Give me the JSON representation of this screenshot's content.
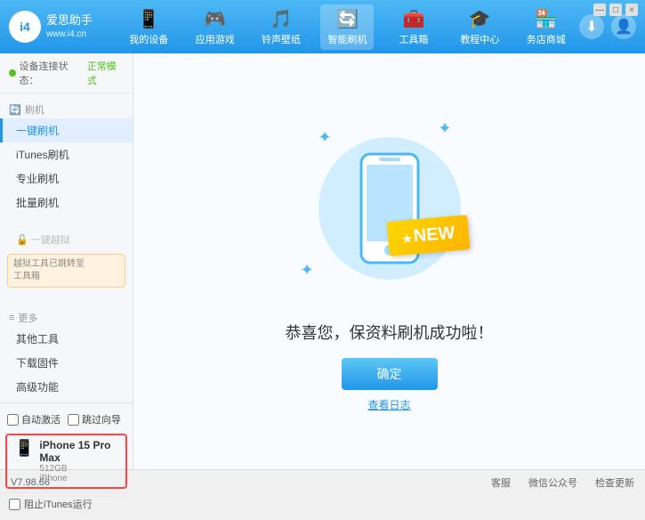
{
  "app": {
    "title": "爱思助手",
    "subtitle": "www.i4.cn",
    "version": "V7.98.66"
  },
  "window_controls": {
    "minimize": "—",
    "maximize": "□",
    "close": "×"
  },
  "nav": {
    "items": [
      {
        "id": "my-device",
        "icon": "📱",
        "label": "我的设备"
      },
      {
        "id": "apps-games",
        "icon": "🎮",
        "label": "应用游戏"
      },
      {
        "id": "ringtones",
        "icon": "🎵",
        "label": "铃声壁纸"
      },
      {
        "id": "smart-brush",
        "icon": "🔄",
        "label": "智能刷机",
        "active": true
      },
      {
        "id": "toolbox",
        "icon": "🧰",
        "label": "工具箱"
      },
      {
        "id": "tutorial",
        "icon": "🎓",
        "label": "教程中心"
      },
      {
        "id": "services",
        "icon": "🏪",
        "label": "务店商城"
      }
    ],
    "download_icon": "⬇",
    "user_icon": "👤"
  },
  "sidebar": {
    "status_label": "设备连接状态：",
    "status_value": "正常模式",
    "groups": [
      {
        "id": "brush",
        "icon": "🔄",
        "label": "刷机",
        "items": [
          {
            "id": "one-key-brush",
            "label": "一键刷机",
            "active": true
          },
          {
            "id": "itunes-brush",
            "label": "iTunes刷机"
          },
          {
            "id": "pro-brush",
            "label": "专业刷机"
          },
          {
            "id": "batch-brush",
            "label": "批量刷机"
          }
        ]
      },
      {
        "id": "one-key-jailbreak",
        "icon": "🔓",
        "label": "一键越狱",
        "disabled": true,
        "notice": "越狱工具已跳转至\n工具箱"
      },
      {
        "id": "more",
        "icon": "≡",
        "label": "更多",
        "items": [
          {
            "id": "other-tools",
            "label": "其他工具"
          },
          {
            "id": "download-firmware",
            "label": "下载固件"
          },
          {
            "id": "advanced",
            "label": "高级功能"
          }
        ]
      }
    ],
    "checkboxes": [
      {
        "id": "auto-activate",
        "label": "自动激活"
      },
      {
        "id": "sync-contacts",
        "label": "跳过向导"
      }
    ],
    "device": {
      "name": "iPhone 15 Pro Max",
      "storage": "512GB",
      "type": "iPhone"
    },
    "itunes_label": "阻止iTunes运行"
  },
  "content": {
    "new_badge": "NEW",
    "success_title": "恭喜您，保资料刷机成功啦！",
    "confirm_btn": "确定",
    "log_link": "查看日志"
  },
  "footer": {
    "version": "V7.98.66",
    "items": [
      {
        "id": "customer-service",
        "label": "客服"
      },
      {
        "id": "wechat",
        "label": "微信公众号"
      },
      {
        "id": "check-update",
        "label": "检查更新"
      }
    ]
  }
}
